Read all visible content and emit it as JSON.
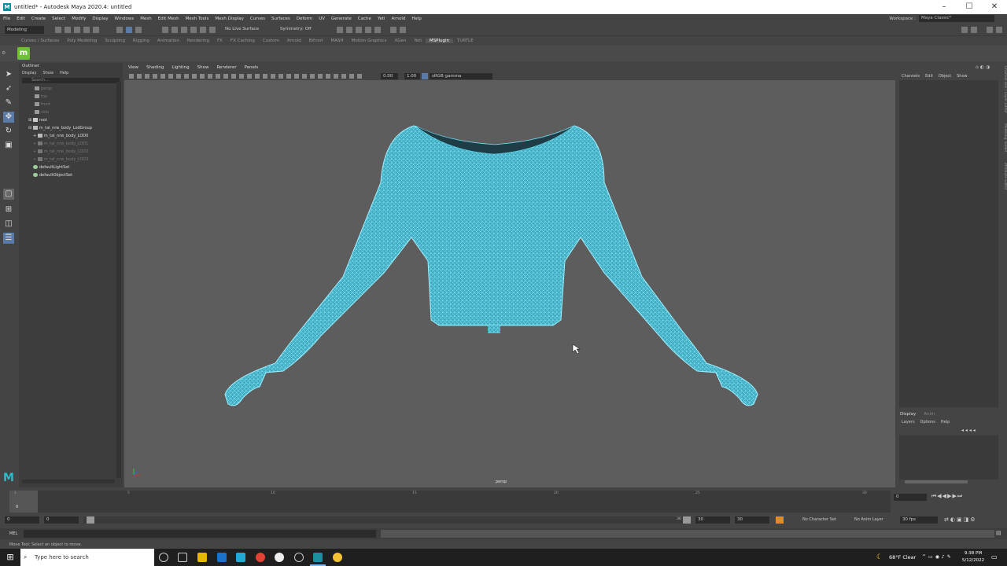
{
  "window": {
    "title": "untitled* - Autodesk Maya 2020.4: untitled",
    "app_icon": "maya-icon"
  },
  "menus": [
    "File",
    "Edit",
    "Create",
    "Select",
    "Modify",
    "Display",
    "Windows",
    "Mesh",
    "Edit Mesh",
    "Mesh Tools",
    "Mesh Display",
    "Curves",
    "Surfaces",
    "Deform",
    "UV",
    "Generate",
    "Cache",
    "Yeti",
    "Arnold",
    "Help"
  ],
  "workspace": {
    "label": "Workspace :",
    "value": "Maya Classic*"
  },
  "toolbar": {
    "mode": "Modeling",
    "live_surface": "No Live Surface",
    "symmetry": "Symmetry: Off"
  },
  "shelf_tabs": [
    "Curves / Surfaces",
    "Poly Modeling",
    "Sculpting",
    "Rigging",
    "Animation",
    "Rendering",
    "FX",
    "FX Caching",
    "Custom",
    "Arnold",
    "Bifrost",
    "MASH",
    "Motion Graphics",
    "XGen",
    "Yeti",
    "MSPlugin",
    "TURTLE"
  ],
  "active_shelf": "MSPlugin",
  "outliner": {
    "title": "Outliner",
    "menu": [
      "Display",
      "Show",
      "Help"
    ],
    "search_placeholder": "Search...",
    "items": [
      {
        "label": "persp",
        "dim": true
      },
      {
        "label": "top",
        "dim": true
      },
      {
        "label": "front",
        "dim": true
      },
      {
        "label": "side",
        "dim": true
      },
      {
        "label": "root",
        "dim": false
      },
      {
        "label": "m_tal_nrw_body_LodGroup",
        "dim": false
      },
      {
        "label": "m_tal_nrw_body_LOD0",
        "dim": false
      },
      {
        "label": "m_tal_nrw_body_LOD1",
        "dim": true
      },
      {
        "label": "m_tal_nrw_body_LOD2",
        "dim": true
      },
      {
        "label": "m_tal_nrw_body_LOD3",
        "dim": true
      },
      {
        "label": "defaultLightSet",
        "dim": false
      },
      {
        "label": "defaultObjectSet",
        "dim": false
      }
    ]
  },
  "viewport": {
    "menu": [
      "View",
      "Shading",
      "Lighting",
      "Show",
      "Renderer",
      "Panels"
    ],
    "exposure": "0.00",
    "gamma": "1.00",
    "color_space": "sRGB gamma",
    "camera_label": "persp",
    "mesh_color": "#5fd3e6"
  },
  "channel_box": {
    "menu": [
      "Channels",
      "Edit",
      "Object",
      "Show"
    ],
    "layer_tabs": [
      "Display",
      "Anim"
    ],
    "layer_menu": [
      "Layers",
      "Options",
      "Help"
    ],
    "side_tabs": [
      "Channel Box / Layer Editor",
      "Modeling Toolkit",
      "Attribute Editor"
    ]
  },
  "timeline": {
    "ticks": [
      "1",
      "5",
      "10",
      "15",
      "20",
      "25",
      "30"
    ],
    "current_frame": "0",
    "frame_field": "0"
  },
  "range": {
    "start": "0",
    "inner_start": "0",
    "inner_end": "30",
    "end_a": "30",
    "end_b": "30",
    "character_set": "No Character Set",
    "anim_layer": "No Anim Layer",
    "fps": "30 fps"
  },
  "mel": {
    "label": "MEL"
  },
  "help_line": "Move Tool: Select an object to move.",
  "taskbar": {
    "search_placeholder": "Type here to search",
    "weather": "68°F  Clear",
    "time": "9:38 PM",
    "date": "5/12/2022"
  }
}
